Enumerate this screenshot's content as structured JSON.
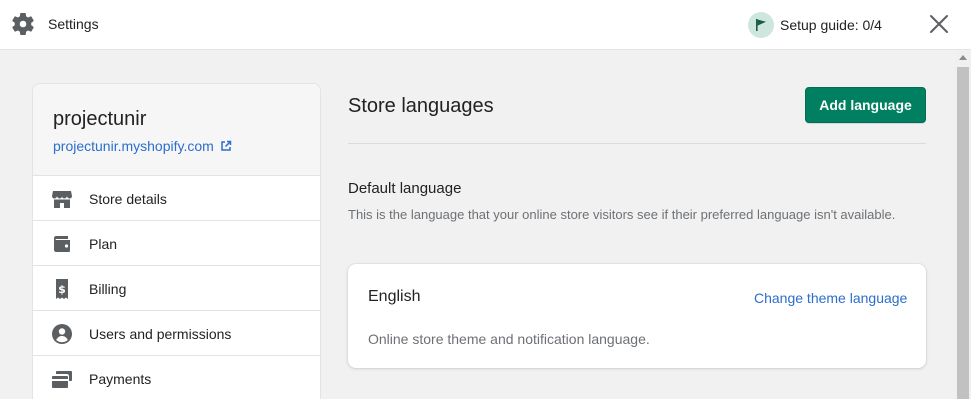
{
  "header": {
    "title": "Settings",
    "setup_guide": "Setup guide: 0/4",
    "icons": {
      "settings": "gear-icon",
      "setup": "flag-icon",
      "close": "close-icon"
    }
  },
  "sidebar": {
    "store_name": "projectunir",
    "store_url": "projectunir.myshopify.com",
    "items": [
      {
        "label": "Store details",
        "icon": "store-icon"
      },
      {
        "label": "Plan",
        "icon": "wallet-icon"
      },
      {
        "label": "Billing",
        "icon": "receipt-icon"
      },
      {
        "label": "Users and permissions",
        "icon": "user-icon"
      },
      {
        "label": "Payments",
        "icon": "payment-icon"
      }
    ]
  },
  "main": {
    "title": "Store languages",
    "add_button": "Add language",
    "default_section": {
      "title": "Default language",
      "description": "This is the language that your online store visitors see if their preferred language isn't available."
    },
    "language_card": {
      "name": "English",
      "action": "Change theme language",
      "note": "Online store theme and notification language."
    }
  },
  "colors": {
    "primary": "#008060",
    "link": "#2c6ecb",
    "flag_bg": "#cde7de"
  }
}
